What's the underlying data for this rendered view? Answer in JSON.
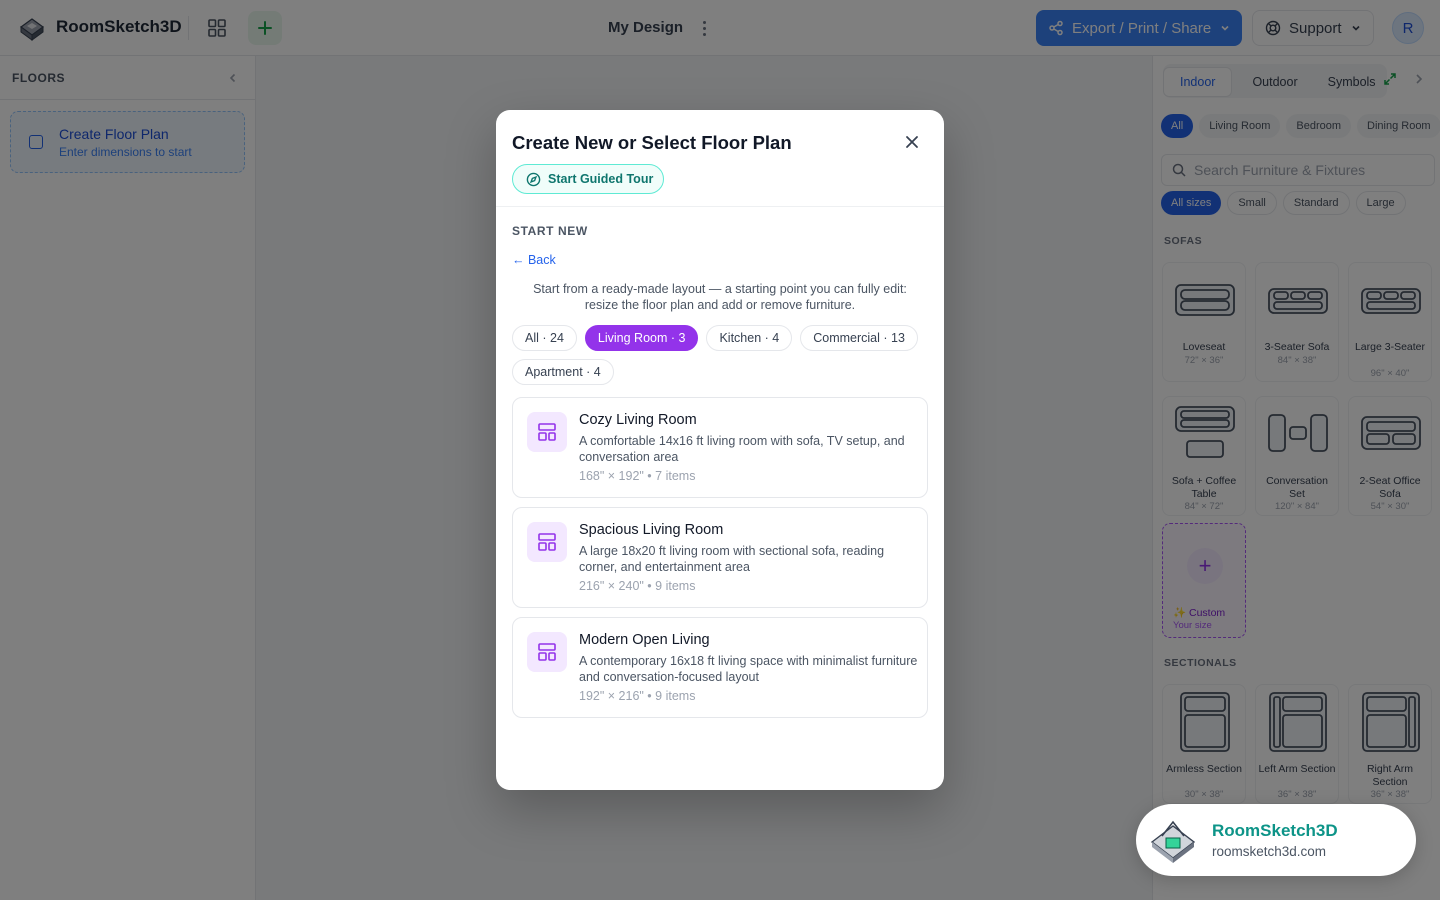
{
  "header": {
    "app_title": "RoomSketch3D",
    "design_title": "My Design",
    "export_label": "Export / Print / Share",
    "support_label": "Support",
    "avatar_initial": "R"
  },
  "left_sidebar": {
    "heading": "FLOORS",
    "create_title": "Create Floor Plan",
    "create_subtitle": "Enter dimensions to start"
  },
  "right_sidebar": {
    "tabs": [
      "Indoor",
      "Outdoor",
      "Symbols"
    ],
    "active_tab": "Indoor",
    "categories": [
      "All",
      "Living Room",
      "Bedroom",
      "Dining Room"
    ],
    "search_placeholder": "Search Furniture & Fixtures",
    "sizes": [
      "All sizes",
      "Small",
      "Standard",
      "Large"
    ],
    "sections": [
      {
        "label": "SOFAS",
        "items": [
          {
            "name": "Loveseat",
            "dim": "72\" × 36\""
          },
          {
            "name": "3-Seater Sofa",
            "dim": "84\" × 38\""
          },
          {
            "name": "Large 3-Seater",
            "dim": "96\" × 40\""
          },
          {
            "name": "Sofa + Coffee Table",
            "dim": "84\" × 72\""
          },
          {
            "name": "Conversation Set",
            "dim": "120\" × 84\""
          },
          {
            "name": "2-Seat Office Sofa",
            "dim": "54\" × 30\""
          }
        ],
        "custom": {
          "name": "Custom",
          "sub": "Your size"
        }
      },
      {
        "label": "SECTIONALS",
        "items": [
          {
            "name": "Armless Section",
            "dim": "30\" × 38\""
          },
          {
            "name": "Left Arm Section",
            "dim": "36\" × 38\""
          },
          {
            "name": "Right Arm Section",
            "dim": "36\" × 38\""
          }
        ]
      }
    ]
  },
  "modal": {
    "title": "Create New or Select Floor Plan",
    "tour_label": "Start Guided Tour",
    "section_label": "START NEW",
    "back_label": "← Back",
    "description": "Start from a ready-made layout — a starting point you can fully edit: resize the floor plan and add or remove furniture.",
    "filters": [
      {
        "label": "All · 24",
        "active": false
      },
      {
        "label": "Living Room · 3",
        "active": true
      },
      {
        "label": "Kitchen · 4",
        "active": false
      },
      {
        "label": "Commercial · 13",
        "active": false
      },
      {
        "label": "Apartment · 4",
        "active": false
      }
    ],
    "templates": [
      {
        "title": "Cozy Living Room",
        "desc": "A comfortable 14x16 ft living room with sofa, TV setup, and conversation area",
        "meta": "168\" × 192\" • 7 items"
      },
      {
        "title": "Spacious Living Room",
        "desc": "A large 18x20 ft living room with sectional sofa, reading corner, and entertainment area",
        "meta": "216\" × 240\" • 9 items"
      },
      {
        "title": "Modern Open Living",
        "desc": "A contemporary 16x18 ft living space with minimalist furniture and conversation-focused layout",
        "meta": "192\" × 216\" • 9 items"
      }
    ]
  },
  "watermark": {
    "title": "RoomSketch3D",
    "url": "roomsketch3d.com"
  },
  "colors": {
    "accent_blue": "#3b82f6",
    "accent_purple": "#9333ea",
    "teal": "#0d9488"
  }
}
